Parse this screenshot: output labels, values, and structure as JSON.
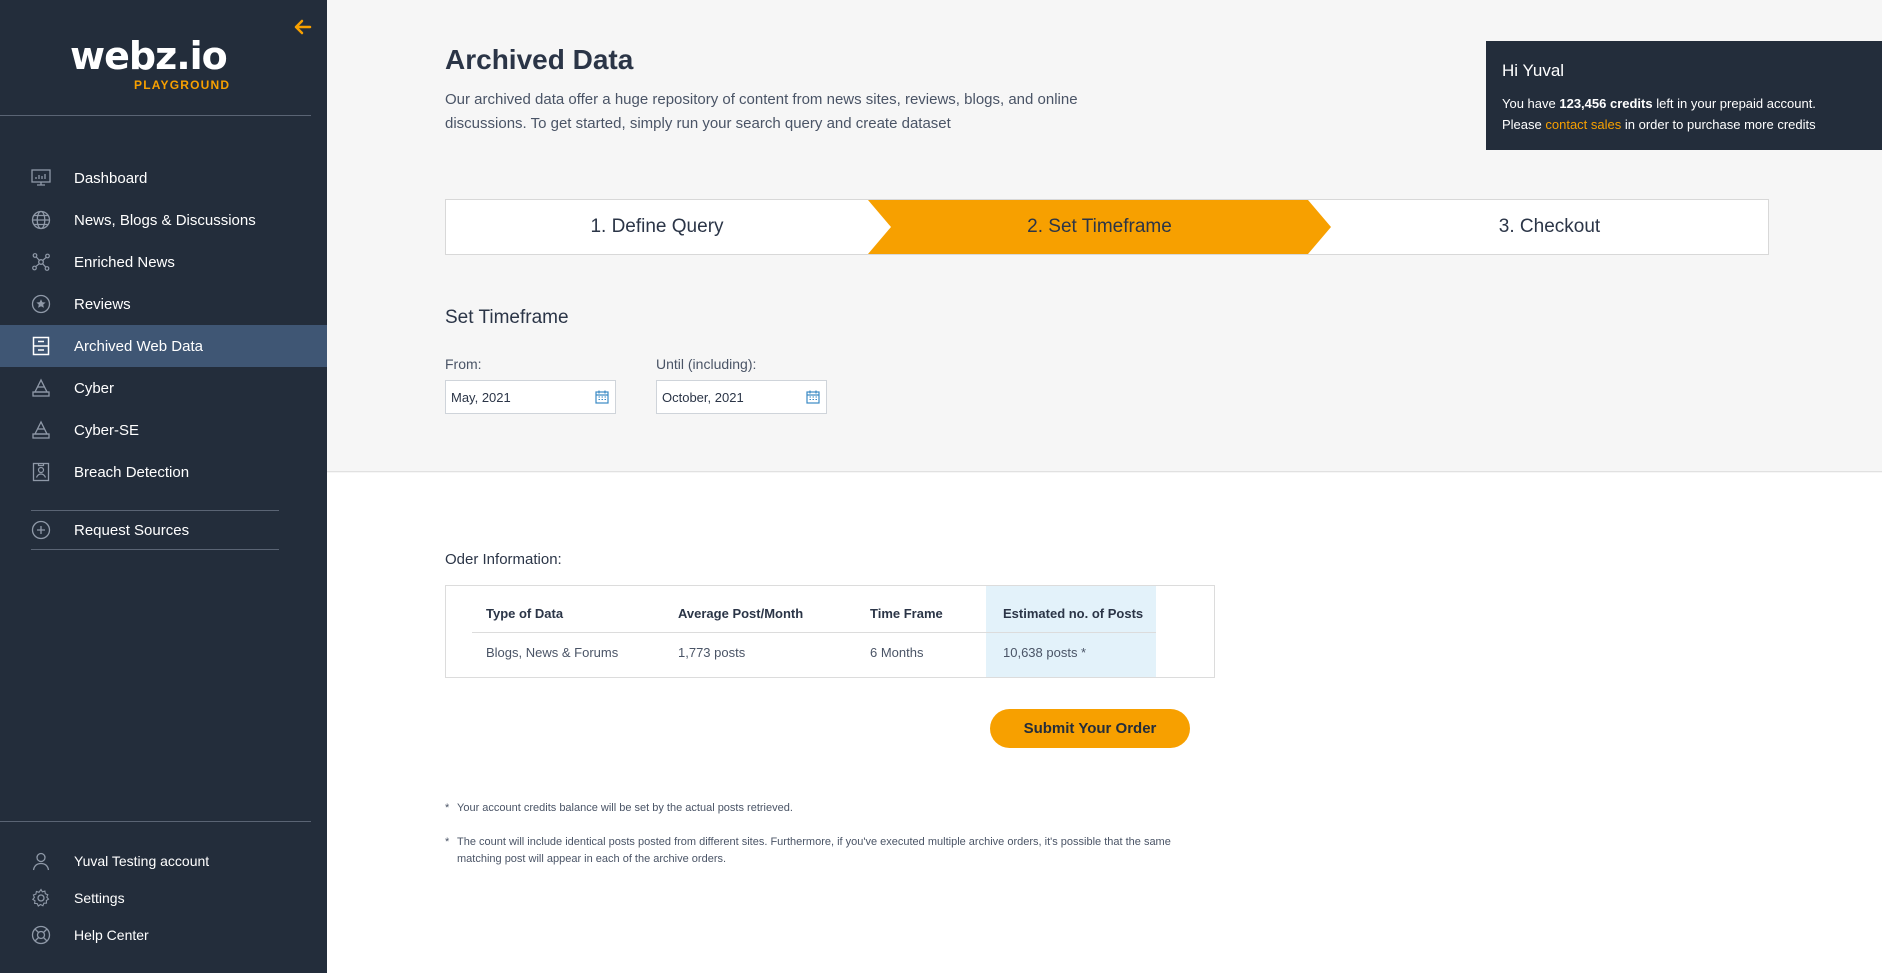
{
  "sidebar": {
    "logo": {
      "main": "webz.io",
      "sub": "PLAYGROUND"
    },
    "collapse_icon": "arrow-left-icon",
    "items": [
      {
        "label": "Dashboard",
        "icon": "dashboard-icon"
      },
      {
        "label": "News, Blogs & Discussions",
        "icon": "globe-icon"
      },
      {
        "label": "Enriched News",
        "icon": "network-icon"
      },
      {
        "label": "Reviews",
        "icon": "star-circle-icon"
      },
      {
        "label": "Archived Web Data",
        "icon": "archive-icon",
        "active": true
      },
      {
        "label": "Cyber",
        "icon": "cyber-icon"
      },
      {
        "label": "Cyber-SE",
        "icon": "cyber-se-icon"
      },
      {
        "label": "Breach Detection",
        "icon": "badge-icon"
      }
    ],
    "request_sources": {
      "label": "Request Sources",
      "icon": "plus-circle-icon"
    },
    "bottom": [
      {
        "label": "Yuval Testing account",
        "icon": "user-icon"
      },
      {
        "label": "Settings",
        "icon": "gear-icon"
      },
      {
        "label": "Help Center",
        "icon": "lifebuoy-icon"
      }
    ]
  },
  "header": {
    "title": "Archived Data",
    "description": "Our archived data offer a huge repository of content from news sites, reviews, blogs, and online discussions. To get started, simply run your search query and create dataset"
  },
  "credits": {
    "greeting": "Hi Yuval",
    "line1_prefix": "You have ",
    "credits_amount": "123,456 credits",
    "line1_suffix": " left in your prepaid account.",
    "line2_prefix": "Please ",
    "link": "contact sales",
    "line2_suffix": " in order to purchase more credits"
  },
  "stepper": {
    "steps": [
      "1. Define Query",
      "2. Set Timeframe",
      "3. Checkout"
    ],
    "active_index": 1,
    "active_color": "#f7a000"
  },
  "timeframe": {
    "title": "Set Timeframe",
    "from_label": "From:",
    "from_value": "May, 2021",
    "until_label": "Until (including):",
    "until_value": "October, 2021"
  },
  "order": {
    "title": "Oder Information:",
    "headers": [
      "Type of Data",
      "Average Post/Month",
      "Time Frame",
      "Estimated no. of Posts"
    ],
    "row": [
      "Blogs, News & Forums",
      "1,773 posts",
      "6 Months",
      "10,638 posts *"
    ]
  },
  "submit_label": "Submit Your Order",
  "notes": [
    "Your account credits balance will be set by the actual posts retrieved.",
    "The count will include identical posts posted from different sites. Furthermore, if you've executed multiple archive orders, it's possible that the same matching post will appear in each of the archive orders."
  ],
  "note_marker": "*",
  "colors": {
    "sidebar": "#232d3b",
    "accent": "#f7a000",
    "active_nav": "#3f5674",
    "estimate_bg": "#e3f2fa"
  }
}
